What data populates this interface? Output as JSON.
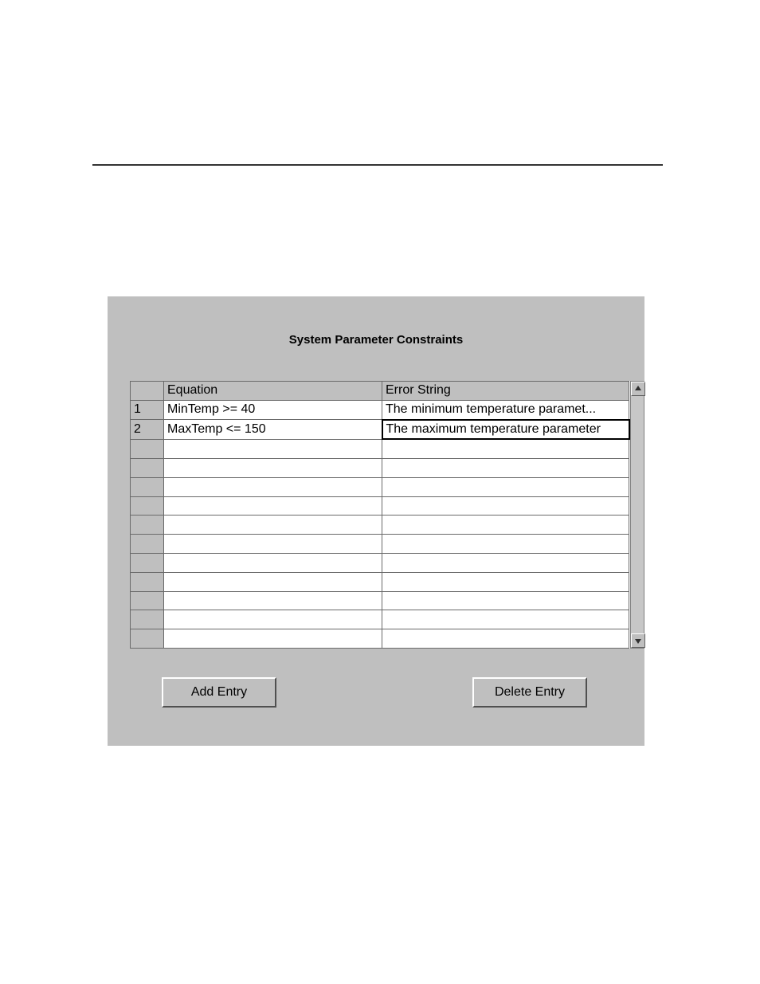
{
  "panel": {
    "title": "System Parameter Constraints",
    "columns": {
      "equation": "Equation",
      "error_string": "Error String"
    },
    "rows": [
      {
        "num": "1",
        "equation": "MinTemp >= 40",
        "error_string": "The minimum temperature paramet...",
        "selected_col": ""
      },
      {
        "num": "2",
        "equation": "MaxTemp <= 150",
        "error_string": "The maximum temperature parameter",
        "selected_col": "error_string"
      },
      {
        "num": "",
        "equation": "",
        "error_string": "",
        "selected_col": ""
      },
      {
        "num": "",
        "equation": "",
        "error_string": "",
        "selected_col": ""
      },
      {
        "num": "",
        "equation": "",
        "error_string": "",
        "selected_col": ""
      },
      {
        "num": "",
        "equation": "",
        "error_string": "",
        "selected_col": ""
      },
      {
        "num": "",
        "equation": "",
        "error_string": "",
        "selected_col": ""
      },
      {
        "num": "",
        "equation": "",
        "error_string": "",
        "selected_col": ""
      },
      {
        "num": "",
        "equation": "",
        "error_string": "",
        "selected_col": ""
      },
      {
        "num": "",
        "equation": "",
        "error_string": "",
        "selected_col": ""
      },
      {
        "num": "",
        "equation": "",
        "error_string": "",
        "selected_col": ""
      },
      {
        "num": "",
        "equation": "",
        "error_string": "",
        "selected_col": ""
      },
      {
        "num": "",
        "equation": "",
        "error_string": "",
        "selected_col": ""
      }
    ],
    "buttons": {
      "add": "Add Entry",
      "delete": "Delete Entry"
    }
  }
}
